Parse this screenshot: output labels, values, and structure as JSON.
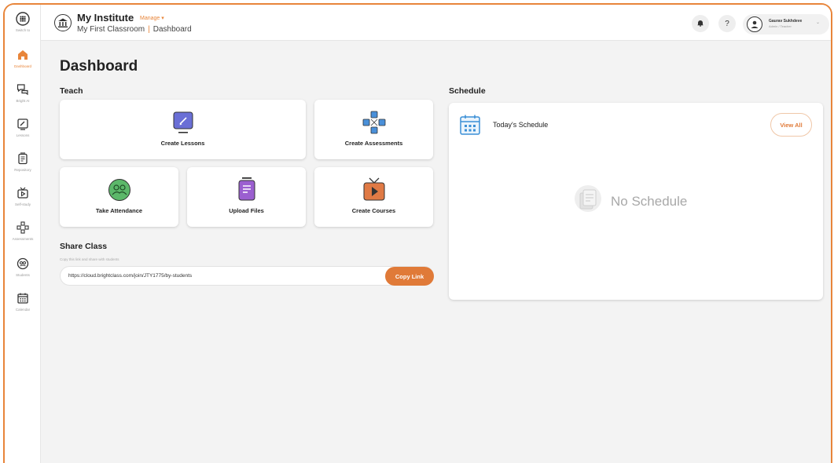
{
  "sidebar": {
    "items": [
      {
        "label": "Switch to",
        "icon": "grid-icon"
      },
      {
        "label": "Dashboard",
        "icon": "home-icon",
        "active": true
      },
      {
        "label": "Bright AI",
        "icon": "chat-icon"
      },
      {
        "label": "Lessons",
        "icon": "edit-icon"
      },
      {
        "label": "Repository",
        "icon": "file-icon"
      },
      {
        "label": "Self-study",
        "icon": "video-icon"
      },
      {
        "label": "Assessments",
        "icon": "assessment-icon"
      },
      {
        "label": "Students",
        "icon": "students-icon"
      },
      {
        "label": "Calendar",
        "icon": "calendar-icon"
      }
    ]
  },
  "header": {
    "institute": "My Institute",
    "manage": "Manage ▾",
    "classroom": "My First Classroom",
    "separator": "|",
    "page": "Dashboard",
    "help": "?",
    "profile": {
      "name": "Gaurav Sukhdeve",
      "role": "Admin / Teacher"
    }
  },
  "main": {
    "title": "Dashboard",
    "teach": {
      "title": "Teach",
      "cards": [
        {
          "label": "Create Lessons",
          "icon": "lesson-icon"
        },
        {
          "label": "Create Assessments",
          "icon": "assessment-icon"
        },
        {
          "label": "Take Attendance",
          "icon": "attendance-icon"
        },
        {
          "label": "Upload Files",
          "icon": "upload-icon"
        },
        {
          "label": "Create Courses",
          "icon": "course-icon"
        }
      ]
    },
    "share": {
      "title": "Share Class",
      "subtitle": "Copy this link and share with students",
      "url": "https://cloud.brightclass.com/join/JTY1775/by-students",
      "copy_label": "Copy Link"
    },
    "schedule": {
      "title": "Schedule",
      "card_title": "Today's Schedule",
      "view_all": "View All",
      "empty": "No Schedule"
    }
  },
  "colors": {
    "accent": "#e8853a",
    "button": "#e07a38"
  }
}
